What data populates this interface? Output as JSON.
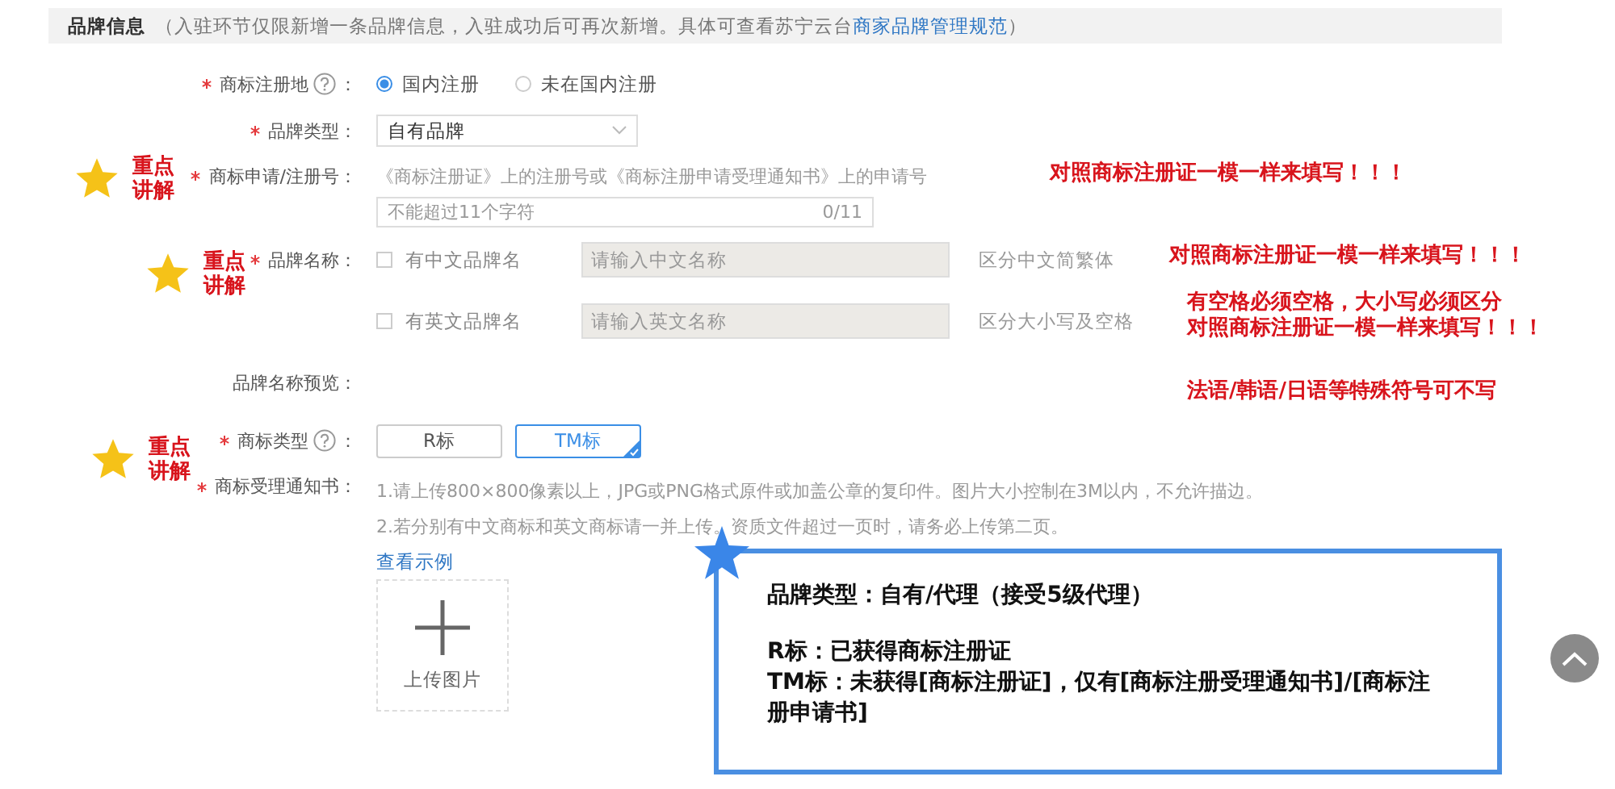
{
  "header": {
    "title": "品牌信息",
    "note": "（入驻环节仅限新增一条品牌信息，入驻成功后可再次新增。具体可查看苏宁云台",
    "link": "商家品牌管理规范",
    "note_end": "）"
  },
  "registration_place": {
    "label": "商标注册地",
    "required": true,
    "suffix": "：",
    "options": [
      {
        "label": "国内注册",
        "selected": true
      },
      {
        "label": "未在国内注册",
        "selected": false
      }
    ]
  },
  "brand_type": {
    "label": "品牌类型：",
    "required": true,
    "value": "自有品牌"
  },
  "trademark_number": {
    "label": "商标申请/注册号：",
    "required": true,
    "hint": "《商标注册证》上的注册号或《商标注册申请受理通知书》上的申请号",
    "placeholder": "不能超过11个字符",
    "counter": "0/11"
  },
  "brand_name": {
    "label": "品牌名称：",
    "required": true,
    "rows": [
      {
        "label": "有中文品牌名",
        "checked": false,
        "placeholder": "请输入中文名称",
        "note": "区分中文简繁体"
      },
      {
        "label": "有英文品牌名",
        "checked": false,
        "placeholder": "请输入英文名称",
        "note": "区分大小写及空格"
      }
    ]
  },
  "preview": {
    "label": "品牌名称预览："
  },
  "trademark_type": {
    "label": "商标类型",
    "required": true,
    "suffix": "：",
    "options": [
      {
        "label": "R标",
        "selected": false
      },
      {
        "label": "TM标",
        "selected": true
      }
    ]
  },
  "notice": {
    "label": "商标受理通知书：",
    "required": true,
    "lines": [
      "1.请上传800×800像素以上，JPG或PNG格式原件或加盖公章的复印件。图片大小控制在3M以内，不允许描边。",
      "2.若分别有中文商标和英文商标请一并上传。资质文件超过一页时，请务必上传第二页。"
    ],
    "link": "查看示例",
    "upload_label": "上传图片"
  },
  "highlights": [
    {
      "lines": [
        "重点",
        "讲解"
      ]
    },
    {
      "lines": [
        "重点",
        "讲解"
      ]
    },
    {
      "lines": [
        "重点",
        "讲解"
      ]
    }
  ],
  "red_notes": [
    {
      "lines": [
        "对照商标注册证一模一样来填写！！！"
      ]
    },
    {
      "lines": [
        "对照商标注册证一模一样来填写！！！"
      ]
    },
    {
      "lines": [
        "有空格必须空格，大小写必须区分",
        "对照商标注册证一模一样来填写！！！"
      ]
    },
    {
      "lines": [
        "法语/韩语/日语等特殊符号可不写"
      ]
    }
  ],
  "callout": {
    "paragraphs": [
      [
        "品牌类型：自有/代理（接受5级代理）"
      ],
      [
        "R标：已获得商标注册证",
        "TM标：未获得[商标注册证]，仅有[商标注册受理通知书]/[商标注册申请书]"
      ]
    ]
  }
}
